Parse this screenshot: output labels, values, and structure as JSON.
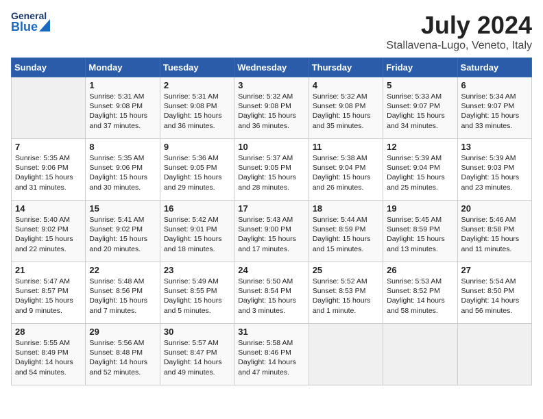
{
  "header": {
    "logo_general": "General",
    "logo_blue": "Blue",
    "title": "July 2024",
    "subtitle": "Stallavena-Lugo, Veneto, Italy"
  },
  "weekdays": [
    "Sunday",
    "Monday",
    "Tuesday",
    "Wednesday",
    "Thursday",
    "Friday",
    "Saturday"
  ],
  "weeks": [
    [
      {
        "day": "",
        "content": ""
      },
      {
        "day": "1",
        "content": "Sunrise: 5:31 AM\nSunset: 9:08 PM\nDaylight: 15 hours\nand 37 minutes."
      },
      {
        "day": "2",
        "content": "Sunrise: 5:31 AM\nSunset: 9:08 PM\nDaylight: 15 hours\nand 36 minutes."
      },
      {
        "day": "3",
        "content": "Sunrise: 5:32 AM\nSunset: 9:08 PM\nDaylight: 15 hours\nand 36 minutes."
      },
      {
        "day": "4",
        "content": "Sunrise: 5:32 AM\nSunset: 9:08 PM\nDaylight: 15 hours\nand 35 minutes."
      },
      {
        "day": "5",
        "content": "Sunrise: 5:33 AM\nSunset: 9:07 PM\nDaylight: 15 hours\nand 34 minutes."
      },
      {
        "day": "6",
        "content": "Sunrise: 5:34 AM\nSunset: 9:07 PM\nDaylight: 15 hours\nand 33 minutes."
      }
    ],
    [
      {
        "day": "7",
        "content": "Sunrise: 5:35 AM\nSunset: 9:06 PM\nDaylight: 15 hours\nand 31 minutes."
      },
      {
        "day": "8",
        "content": "Sunrise: 5:35 AM\nSunset: 9:06 PM\nDaylight: 15 hours\nand 30 minutes."
      },
      {
        "day": "9",
        "content": "Sunrise: 5:36 AM\nSunset: 9:05 PM\nDaylight: 15 hours\nand 29 minutes."
      },
      {
        "day": "10",
        "content": "Sunrise: 5:37 AM\nSunset: 9:05 PM\nDaylight: 15 hours\nand 28 minutes."
      },
      {
        "day": "11",
        "content": "Sunrise: 5:38 AM\nSunset: 9:04 PM\nDaylight: 15 hours\nand 26 minutes."
      },
      {
        "day": "12",
        "content": "Sunrise: 5:39 AM\nSunset: 9:04 PM\nDaylight: 15 hours\nand 25 minutes."
      },
      {
        "day": "13",
        "content": "Sunrise: 5:39 AM\nSunset: 9:03 PM\nDaylight: 15 hours\nand 23 minutes."
      }
    ],
    [
      {
        "day": "14",
        "content": "Sunrise: 5:40 AM\nSunset: 9:02 PM\nDaylight: 15 hours\nand 22 minutes."
      },
      {
        "day": "15",
        "content": "Sunrise: 5:41 AM\nSunset: 9:02 PM\nDaylight: 15 hours\nand 20 minutes."
      },
      {
        "day": "16",
        "content": "Sunrise: 5:42 AM\nSunset: 9:01 PM\nDaylight: 15 hours\nand 18 minutes."
      },
      {
        "day": "17",
        "content": "Sunrise: 5:43 AM\nSunset: 9:00 PM\nDaylight: 15 hours\nand 17 minutes."
      },
      {
        "day": "18",
        "content": "Sunrise: 5:44 AM\nSunset: 8:59 PM\nDaylight: 15 hours\nand 15 minutes."
      },
      {
        "day": "19",
        "content": "Sunrise: 5:45 AM\nSunset: 8:59 PM\nDaylight: 15 hours\nand 13 minutes."
      },
      {
        "day": "20",
        "content": "Sunrise: 5:46 AM\nSunset: 8:58 PM\nDaylight: 15 hours\nand 11 minutes."
      }
    ],
    [
      {
        "day": "21",
        "content": "Sunrise: 5:47 AM\nSunset: 8:57 PM\nDaylight: 15 hours\nand 9 minutes."
      },
      {
        "day": "22",
        "content": "Sunrise: 5:48 AM\nSunset: 8:56 PM\nDaylight: 15 hours\nand 7 minutes."
      },
      {
        "day": "23",
        "content": "Sunrise: 5:49 AM\nSunset: 8:55 PM\nDaylight: 15 hours\nand 5 minutes."
      },
      {
        "day": "24",
        "content": "Sunrise: 5:50 AM\nSunset: 8:54 PM\nDaylight: 15 hours\nand 3 minutes."
      },
      {
        "day": "25",
        "content": "Sunrise: 5:52 AM\nSunset: 8:53 PM\nDaylight: 15 hours\nand 1 minute."
      },
      {
        "day": "26",
        "content": "Sunrise: 5:53 AM\nSunset: 8:52 PM\nDaylight: 14 hours\nand 58 minutes."
      },
      {
        "day": "27",
        "content": "Sunrise: 5:54 AM\nSunset: 8:50 PM\nDaylight: 14 hours\nand 56 minutes."
      }
    ],
    [
      {
        "day": "28",
        "content": "Sunrise: 5:55 AM\nSunset: 8:49 PM\nDaylight: 14 hours\nand 54 minutes."
      },
      {
        "day": "29",
        "content": "Sunrise: 5:56 AM\nSunset: 8:48 PM\nDaylight: 14 hours\nand 52 minutes."
      },
      {
        "day": "30",
        "content": "Sunrise: 5:57 AM\nSunset: 8:47 PM\nDaylight: 14 hours\nand 49 minutes."
      },
      {
        "day": "31",
        "content": "Sunrise: 5:58 AM\nSunset: 8:46 PM\nDaylight: 14 hours\nand 47 minutes."
      },
      {
        "day": "",
        "content": ""
      },
      {
        "day": "",
        "content": ""
      },
      {
        "day": "",
        "content": ""
      }
    ]
  ]
}
